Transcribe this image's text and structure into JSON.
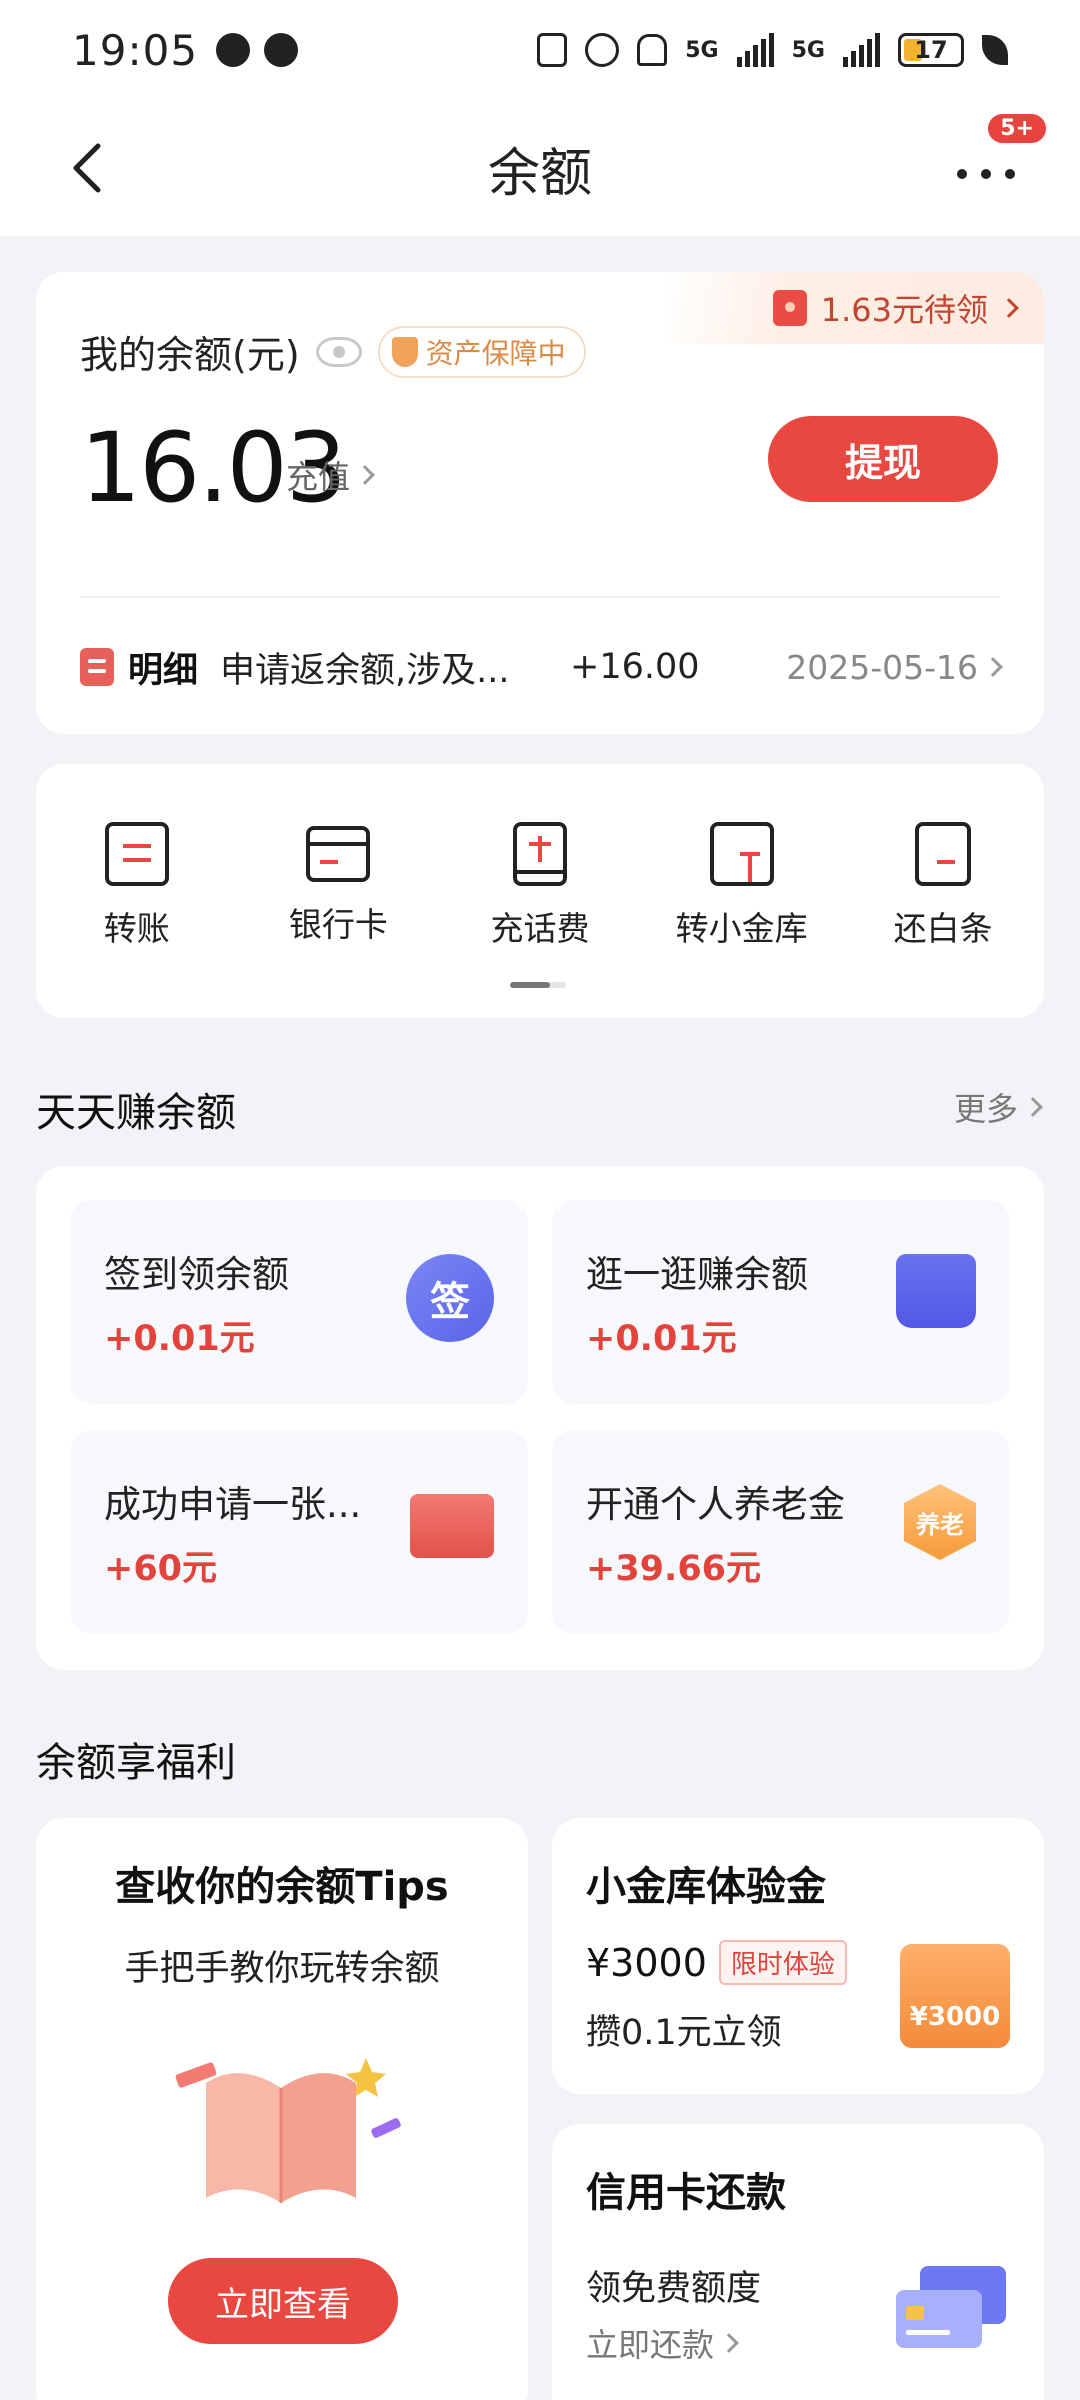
{
  "status_bar": {
    "time": "19:05",
    "network": "5G",
    "battery": "17"
  },
  "nav": {
    "title": "余额",
    "badge": "5+"
  },
  "balance": {
    "redpacket_text": "1.63元待领",
    "label": "我的余额(元)",
    "protect_badge": "资产保障中",
    "amount": "16.03",
    "recharge_label": "充值",
    "withdraw_label": "提现",
    "detail": {
      "label": "明细",
      "description": "申请返余额,涉及...",
      "amount": "+16.00",
      "date": "2025-05-16"
    }
  },
  "quick_actions": [
    {
      "label": "转账",
      "icon": "transfer-icon"
    },
    {
      "label": "银行卡",
      "icon": "bank-card-icon"
    },
    {
      "label": "充话费",
      "icon": "phone-recharge-icon"
    },
    {
      "label": "转小金库",
      "icon": "vault-transfer-icon"
    },
    {
      "label": "还白条",
      "icon": "repay-icon"
    }
  ],
  "earn": {
    "title": "天天赚余额",
    "more": "更多",
    "tasks": [
      {
        "title": "签到领余额",
        "reward": "+0.01元",
        "icon_text": "签"
      },
      {
        "title": "逛一逛赚余额",
        "reward": "+0.01元"
      },
      {
        "title": "成功申请一张...",
        "reward": "+60元"
      },
      {
        "title": "开通个人养老金",
        "reward": "+39.66元",
        "icon_text": "养老"
      }
    ]
  },
  "benefits": {
    "title": "余额享福利",
    "tips": {
      "title": "查收你的余额Tips",
      "subtitle": "手把手教你玩转余额",
      "button": "立即查看"
    },
    "vault": {
      "title": "小金库体验金",
      "amount": "¥3000",
      "tag": "限时体验",
      "desc": "攒0.1元立领",
      "envelope_text": "¥3000"
    },
    "credit": {
      "title": "信用卡还款",
      "desc": "领免费额度",
      "link": "立即还款"
    }
  },
  "colors": {
    "accent": "#e8483f",
    "background": "#f3f3f7",
    "reward": "#e2443c"
  }
}
